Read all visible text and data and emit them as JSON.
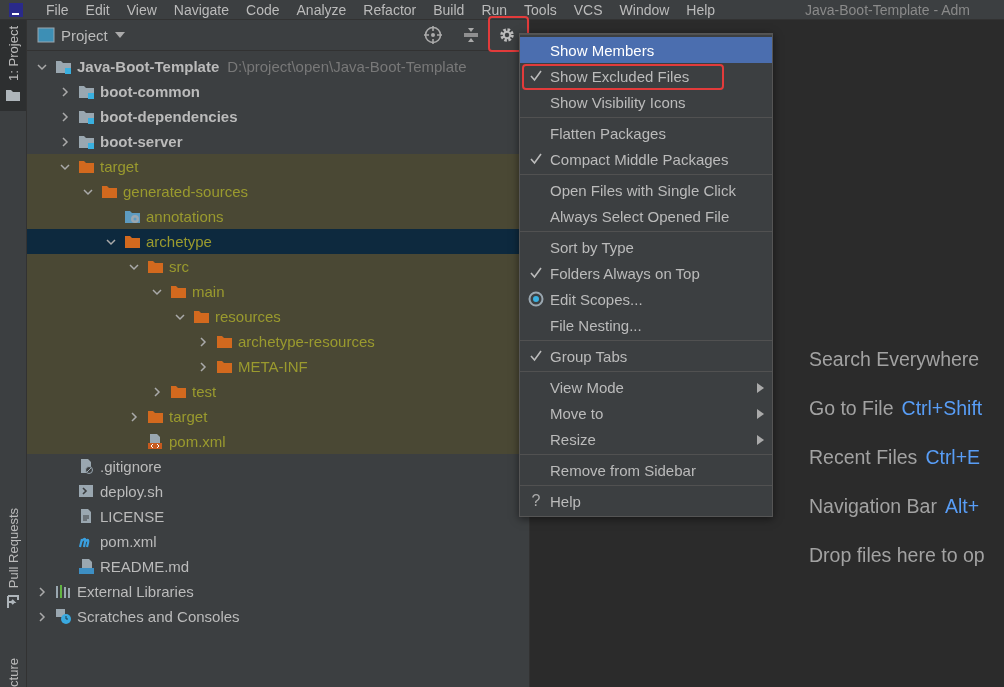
{
  "menu_bar": {
    "items": [
      "File",
      "Edit",
      "View",
      "Navigate",
      "Code",
      "Analyze",
      "Refactor",
      "Build",
      "Run",
      "Tools",
      "VCS",
      "Window",
      "Help"
    ],
    "title": "Java-Boot-Template - Adm"
  },
  "tool_windows": [
    {
      "label": "1: Project",
      "selected": true
    },
    {
      "label": "Pull Requests",
      "selected": false
    },
    {
      "label": "cture",
      "selected": false
    }
  ],
  "project_panel": {
    "title": "Project",
    "settings_annotated": true
  },
  "tree": {
    "items": [
      {
        "label": "Java-Boot-Template",
        "path": "D:\\project\\open\\Java-Boot-Template",
        "kind": "module",
        "bold": true,
        "expanded": true,
        "excluded": false,
        "selected": false,
        "children": [
          {
            "label": "boot-common",
            "kind": "module",
            "bold": true,
            "expanded": false,
            "excluded": false,
            "selected": false
          },
          {
            "label": "boot-dependencies",
            "kind": "module",
            "bold": true,
            "expanded": false,
            "excluded": false,
            "selected": false
          },
          {
            "label": "boot-server",
            "kind": "module",
            "bold": true,
            "expanded": false,
            "excluded": false,
            "selected": false
          },
          {
            "label": "target",
            "kind": "folder",
            "bold": false,
            "expanded": true,
            "excluded": true,
            "selected": false,
            "children": [
              {
                "label": "generated-sources",
                "kind": "folder",
                "bold": false,
                "expanded": true,
                "excluded": true,
                "selected": false,
                "children": [
                  {
                    "label": "annotations",
                    "kind": "generated",
                    "bold": false,
                    "excluded": true,
                    "selected": false
                  },
                  {
                    "label": "archetype",
                    "kind": "folder",
                    "bold": false,
                    "expanded": true,
                    "excluded": true,
                    "selected": true,
                    "children": [
                      {
                        "label": "src",
                        "kind": "folder",
                        "bold": false,
                        "expanded": true,
                        "excluded": true,
                        "selected": false,
                        "children": [
                          {
                            "label": "main",
                            "kind": "folder",
                            "bold": false,
                            "expanded": true,
                            "excluded": true,
                            "selected": false,
                            "children": [
                              {
                                "label": "resources",
                                "kind": "folder",
                                "bold": false,
                                "expanded": true,
                                "excluded": true,
                                "selected": false,
                                "children": [
                                  {
                                    "label": "archetype-resources",
                                    "kind": "folder",
                                    "bold": false,
                                    "expanded": false,
                                    "excluded": true,
                                    "selected": false
                                  },
                                  {
                                    "label": "META-INF",
                                    "kind": "folder",
                                    "bold": false,
                                    "expanded": false,
                                    "excluded": true,
                                    "selected": false
                                  }
                                ]
                              }
                            ]
                          },
                          {
                            "label": "test",
                            "kind": "folder",
                            "bold": false,
                            "expanded": false,
                            "excluded": true,
                            "selected": false
                          }
                        ]
                      },
                      {
                        "label": "target",
                        "kind": "folder",
                        "bold": false,
                        "expanded": false,
                        "excluded": true,
                        "selected": false
                      },
                      {
                        "label": "pom.xml",
                        "kind": "xml",
                        "bold": false,
                        "excluded": true,
                        "selected": false
                      }
                    ]
                  }
                ]
              }
            ]
          },
          {
            "label": ".gitignore",
            "kind": "ignore",
            "bold": false,
            "excluded": false,
            "selected": false
          },
          {
            "label": "deploy.sh",
            "kind": "shell",
            "bold": false,
            "excluded": false,
            "selected": false
          },
          {
            "label": "LICENSE",
            "kind": "text",
            "bold": false,
            "excluded": false,
            "selected": false
          },
          {
            "label": "pom.xml",
            "kind": "maven",
            "bold": false,
            "excluded": false,
            "selected": false
          },
          {
            "label": "README.md",
            "kind": "markdown",
            "bold": false,
            "excluded": false,
            "selected": false
          }
        ]
      },
      {
        "label": "External Libraries",
        "kind": "libraries",
        "bold": false,
        "expanded": false,
        "excluded": false,
        "selected": false
      },
      {
        "label": "Scratches and Consoles",
        "kind": "scratches",
        "bold": false,
        "expanded": false,
        "excluded": false,
        "selected": false
      }
    ]
  },
  "popup_menu": {
    "groups": [
      [
        {
          "label": "Show Members",
          "kind": "check",
          "checked": false,
          "selected": true,
          "annotated": false
        },
        {
          "label": "Show Excluded Files",
          "kind": "check",
          "checked": true,
          "selected": false,
          "annotated": true
        },
        {
          "label": "Show Visibility Icons",
          "kind": "check",
          "checked": false,
          "selected": false,
          "annotated": false
        }
      ],
      [
        {
          "label": "Flatten Packages",
          "kind": "check",
          "checked": false,
          "selected": false,
          "annotated": false
        },
        {
          "label": "Compact Middle Packages",
          "kind": "check",
          "checked": true,
          "selected": false,
          "annotated": false
        }
      ],
      [
        {
          "label": "Open Files with Single Click",
          "kind": "check",
          "checked": false,
          "selected": false,
          "annotated": false
        },
        {
          "label": "Always Select Opened File",
          "kind": "check",
          "checked": false,
          "selected": false,
          "annotated": false
        }
      ],
      [
        {
          "label": "Sort by Type",
          "kind": "check",
          "checked": false,
          "selected": false,
          "annotated": false
        },
        {
          "label": "Folders Always on Top",
          "kind": "check",
          "checked": true,
          "selected": false,
          "annotated": false
        },
        {
          "label": "Edit Scopes...",
          "kind": "scope",
          "selected": false,
          "annotated": false
        },
        {
          "label": "File Nesting...",
          "kind": "action",
          "selected": false,
          "annotated": false
        }
      ],
      [
        {
          "label": "Group Tabs",
          "kind": "check",
          "checked": true,
          "selected": false,
          "annotated": false
        }
      ],
      [
        {
          "label": "View Mode",
          "kind": "submenu",
          "selected": false,
          "annotated": false
        },
        {
          "label": "Move to",
          "kind": "submenu",
          "selected": false,
          "annotated": false
        },
        {
          "label": "Resize",
          "kind": "submenu",
          "selected": false,
          "annotated": false
        }
      ],
      [
        {
          "label": "Remove from Sidebar",
          "kind": "action",
          "selected": false,
          "annotated": false
        }
      ],
      [
        {
          "label": "Help",
          "kind": "help",
          "glyph": "?",
          "selected": false,
          "annotated": false
        }
      ]
    ]
  },
  "editor_hints": [
    {
      "label": "Search Everywhere"
    },
    {
      "label": "Go to File",
      "shortcut": "Ctrl+Shift"
    },
    {
      "label": "Recent Files",
      "shortcut": "Ctrl+E"
    },
    {
      "label": "Navigation Bar",
      "shortcut": "Alt+"
    },
    {
      "label": "Drop files here to op"
    }
  ]
}
